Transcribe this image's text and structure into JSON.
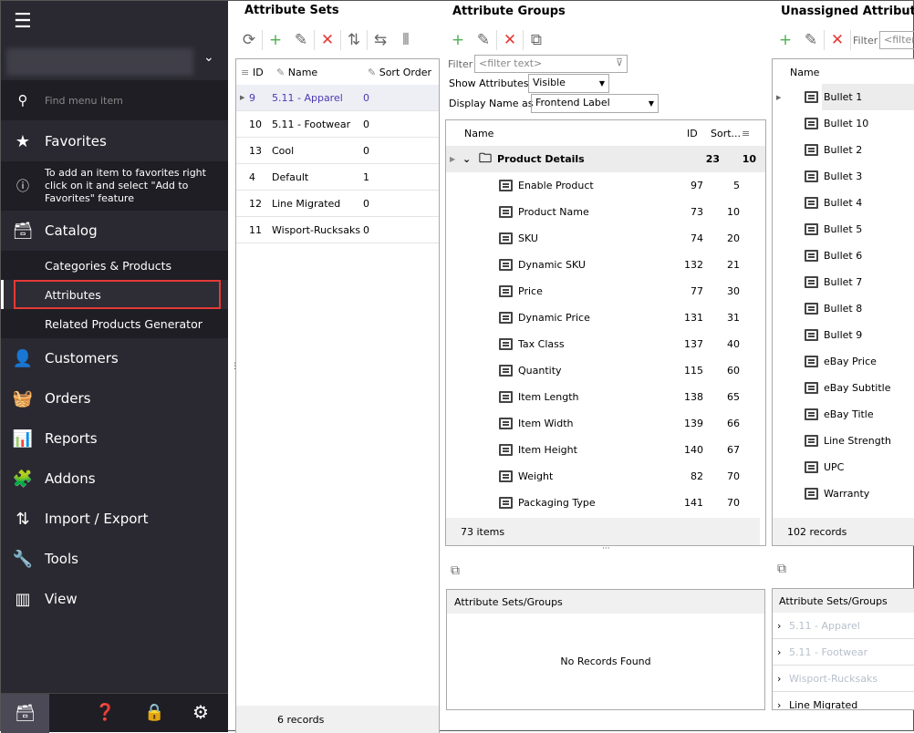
{
  "sidebar": {
    "search_placeholder": "Find menu item",
    "favorites": "Favorites",
    "favorites_hint": "To add an item to favorites right click on it and select \"Add to Favorites\" feature",
    "catalog": "Catalog",
    "catalog_items": [
      "Categories & Products",
      "Attributes",
      "Related Products Generator"
    ],
    "selected": "Attributes",
    "items": [
      {
        "label": "Customers",
        "icon": "user-icon",
        "glyph": "👤"
      },
      {
        "label": "Orders",
        "icon": "basket-icon",
        "glyph": "🧺"
      },
      {
        "label": "Reports",
        "icon": "chart-icon",
        "glyph": "📊"
      },
      {
        "label": "Addons",
        "icon": "puzzle-icon",
        "glyph": "🧩"
      },
      {
        "label": "Import / Export",
        "icon": "import-export-icon",
        "glyph": "⇅"
      },
      {
        "label": "Tools",
        "icon": "wrench-icon",
        "glyph": "🔧"
      },
      {
        "label": "View",
        "icon": "view-icon",
        "glyph": "▥"
      }
    ],
    "highlight_color": "#e53935"
  },
  "sets": {
    "title": "Attribute Sets",
    "columns": [
      "ID",
      "Name",
      "Sort Order"
    ],
    "rows": [
      [
        "9",
        "5.11 - Apparel",
        "0"
      ],
      [
        "10",
        "5.11 - Footwear",
        "0"
      ],
      [
        "13",
        "Cool",
        "0"
      ],
      [
        "4",
        "Default",
        "1"
      ],
      [
        "12",
        "Line Migrated",
        "0"
      ],
      [
        "11",
        "Wisport-Rucksaks",
        "0"
      ]
    ],
    "footer": "6 records"
  },
  "groups": {
    "title": "Attribute Groups",
    "filter_label": "Filter",
    "filter_placeholder": "<filter text>",
    "show_label": "Show Attributes",
    "show_value": "Visible",
    "display_label": "Display Name as",
    "display_value": "Frontend Label",
    "columns": [
      "Name",
      "ID",
      "Sort..."
    ],
    "group": {
      "name": "Product Details",
      "id": "23",
      "sort": "10"
    },
    "rows": [
      [
        "Enable Product",
        "97",
        "5"
      ],
      [
        "Product Name",
        "73",
        "10"
      ],
      [
        "SKU",
        "74",
        "20"
      ],
      [
        "Dynamic SKU",
        "132",
        "21"
      ],
      [
        "Price",
        "77",
        "30"
      ],
      [
        "Dynamic Price",
        "131",
        "31"
      ],
      [
        "Tax Class",
        "137",
        "40"
      ],
      [
        "Quantity",
        "115",
        "60"
      ],
      [
        "Item Length",
        "138",
        "65"
      ],
      [
        "Item Width",
        "139",
        "66"
      ],
      [
        "Item Height",
        "140",
        "67"
      ],
      [
        "Weight",
        "82",
        "70"
      ],
      [
        "Packaging Type",
        "141",
        "70"
      ]
    ],
    "footer": "73 items",
    "lower_title": "Attribute Sets/Groups",
    "lower_empty": "No Records Found"
  },
  "unassigned": {
    "title": "Unassigned Attributes",
    "filter_label": "Filter",
    "filter_placeholder": "<filter text>",
    "column": "Name",
    "rows": [
      "Bullet 1",
      "Bullet 10",
      "Bullet 2",
      "Bullet 3",
      "Bullet 4",
      "Bullet 5",
      "Bullet 6",
      "Bullet 7",
      "Bullet 8",
      "Bullet 9",
      "eBay Price",
      "eBay Subtitle",
      "eBay Title",
      "Line Strength",
      "UPC",
      "Warranty"
    ],
    "footer": "102 records",
    "lower_title": "Attribute Sets/Groups",
    "lower_rows": [
      {
        "label": "5.11 - Apparel",
        "disabled": true
      },
      {
        "label": "5.11 - Footwear",
        "disabled": true
      },
      {
        "label": "Wisport-Rucksaks",
        "disabled": true
      },
      {
        "label": "Line Migrated",
        "disabled": false
      }
    ]
  }
}
